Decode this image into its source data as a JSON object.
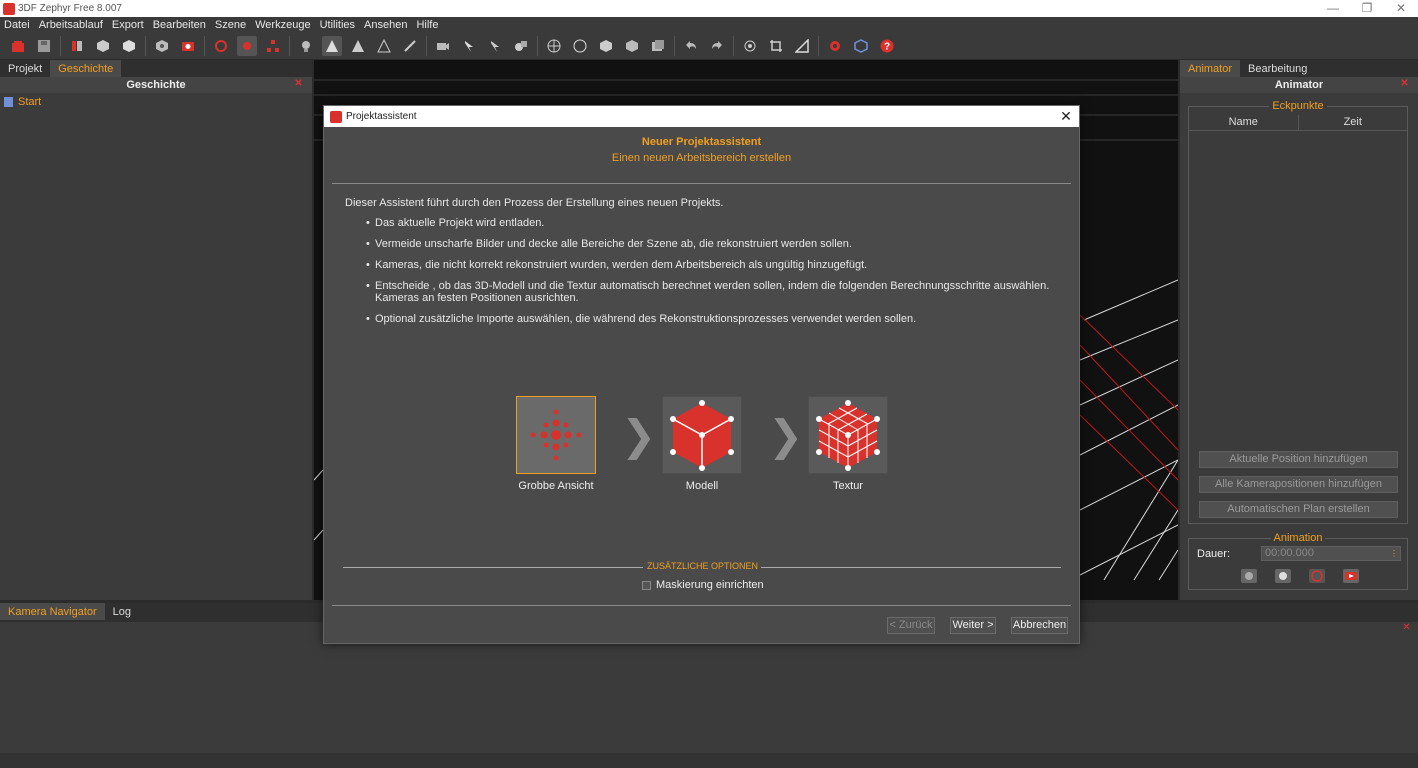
{
  "window": {
    "title": "3DF Zephyr Free 8.007"
  },
  "menu": [
    "Datei",
    "Arbeitsablauf",
    "Export",
    "Bearbeiten",
    "Szene",
    "Werkzeuge",
    "Utilities",
    "Ansehen",
    "Hilfe"
  ],
  "left_panel": {
    "tabs": [
      "Projekt",
      "Geschichte"
    ],
    "active_tab": "Geschichte",
    "header": "Geschichte",
    "items": [
      "Start"
    ]
  },
  "right_panel": {
    "tabs": [
      "Animator",
      "Bearbeitung"
    ],
    "active_tab": "Animator",
    "header": "Animator",
    "keypoints_title": "Eckpunkte",
    "columns": [
      "Name",
      "Zeit"
    ],
    "buttons": [
      "Aktuelle Position hinzufügen",
      "Alle Kamerapositionen hinzufügen",
      "Automatischen Plan erstellen"
    ],
    "animation_title": "Animation",
    "duration_label": "Dauer:",
    "duration_value": "00:00.000"
  },
  "bottom_panel": {
    "tabs": [
      "Kamera Navigator",
      "Log"
    ],
    "active_tab": "Kamera Navigator"
  },
  "dialog": {
    "title": "Projektassistent",
    "heading": "Neuer Projektassistent",
    "subheading": "Einen neuen Arbeitsbereich erstellen",
    "intro": "Dieser Assistent führt durch den Prozess der Erstellung eines neuen Projekts.",
    "bullets": [
      "Das aktuelle Projekt wird entladen.",
      "Vermeide unscharfe Bilder und decke alle Bereiche der Szene ab, die rekonstruiert werden sollen.",
      "Kameras, die nicht korrekt rekonstruiert wurden, werden dem Arbeitsbereich als ungültig hinzugefügt.",
      "Entscheide , ob das 3D-Modell und die Textur automatisch berechnet werden sollen, indem die folgenden Berechnungsschritte auswählen. Kameras an festen Positionen ausrichten.",
      "Optional zusätzliche Importe auswählen, die während des Rekonstruktionsprozesses verwendet werden sollen."
    ],
    "steps": [
      {
        "label": "Grobbe Ansicht",
        "selected": true
      },
      {
        "label": "Modell",
        "selected": false
      },
      {
        "label": "Textur",
        "selected": false
      }
    ],
    "extra_options_title": "ZUSÄTZLICHE OPTIONEN",
    "masking_label": "Maskierung einrichten",
    "masking_checked": false,
    "buttons": {
      "back": "< Zurück",
      "next": "Weiter >",
      "cancel": "Abbrechen"
    }
  },
  "colors": {
    "accent": "#f0a020",
    "brand_red": "#d9312b",
    "panel": "#3b3b3b",
    "dialog": "#4a4a4a"
  }
}
